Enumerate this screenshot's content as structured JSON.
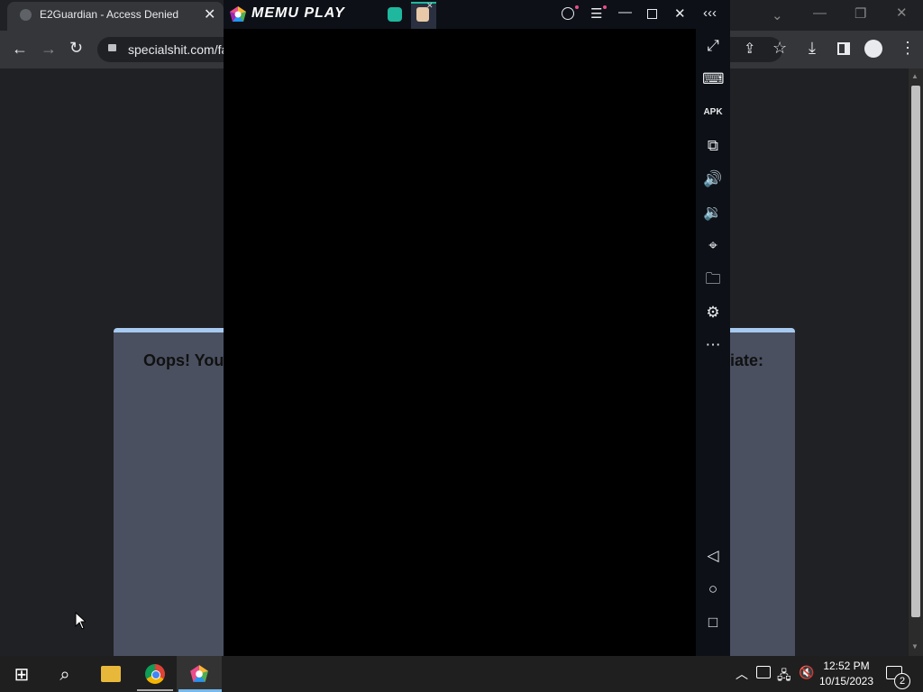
{
  "browser": {
    "tab_title": "E2Guardian - Access Denied",
    "url": "specialshit.com/fa",
    "icons": {
      "back": "back-arrow-icon",
      "forward": "forward-arrow-icon",
      "reload": "reload-icon",
      "lock": "lock-icon",
      "share": "share-icon",
      "star": "bookmark-star-icon",
      "download": "download-icon",
      "sidepanel": "side-panel-icon",
      "profile": "profile-icon",
      "menu": "kebab-menu-icon"
    }
  },
  "page": {
    "card_left_text": "Oops! You",
    "card_right_text": "iate:"
  },
  "memu": {
    "brand": "MEMU PLAY",
    "sidebar_icons": [
      "fullscreen-icon",
      "keyboard-icon",
      "apk-icon",
      "multi-instance-icon",
      "volume-up-icon",
      "volume-down-icon",
      "location-icon",
      "folder-icon",
      "settings-icon",
      "more-icon",
      "android-back-icon",
      "android-home-icon",
      "android-recents-icon"
    ]
  },
  "taskbar": {
    "time": "12:52 PM",
    "date": "10/15/2023",
    "notification_count": "2"
  },
  "colors": {
    "accent": "#a8c9f0",
    "taskbar_active": "#76b9ed"
  }
}
